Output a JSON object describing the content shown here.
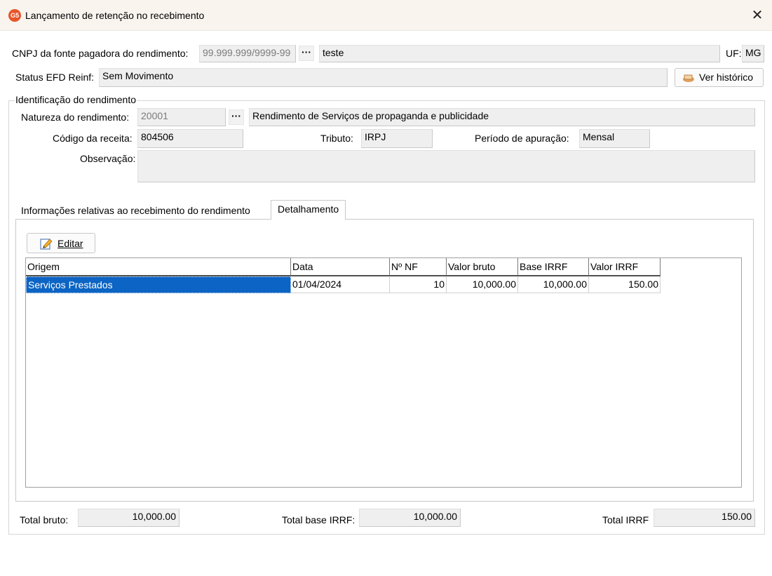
{
  "window": {
    "title": "Lançamento de retenção no recebimento",
    "icon_text": "G5",
    "close_glyph": "✕"
  },
  "header": {
    "cnpj_label": "CNPJ da fonte pagadora do rendimento:",
    "cnpj_value": "99.999.999/9999-99",
    "cnpj_lookup": "···",
    "cnpj_name": "teste",
    "uf_label": "UF:",
    "uf_value": "MG",
    "status_label": "Status EFD Reinf:",
    "status_value": "Sem Movimento",
    "history_button": "Ver histórico"
  },
  "identificacao": {
    "group_title": "Identificação do rendimento",
    "natureza_label": "Natureza do rendimento:",
    "natureza_code": "20001",
    "natureza_lookup": "···",
    "natureza_desc": "Rendimento de Serviços de propaganda e publicidade",
    "codigo_label": "Código da receita:",
    "codigo_value": "804506",
    "tributo_label": "Tributo:",
    "tributo_value": "IRPJ",
    "periodo_label": "Período de apuração:",
    "periodo_value": "Mensal",
    "observacao_label": "Observação:",
    "observacao_value": ""
  },
  "tabs": [
    {
      "label": "Informações relativas ao recebimento do rendimento",
      "active": false
    },
    {
      "label": "Detalhamento",
      "active": true
    }
  ],
  "detalhamento": {
    "edit_button": "Editar",
    "columns": [
      "Origem",
      "Data",
      "Nº NF",
      "Valor bruto",
      "Base IRRF",
      "Valor IRRF"
    ],
    "rows": [
      {
        "origem": "Serviços Prestados",
        "data": "01/04/2024",
        "nf": "10",
        "valor_bruto": "10,000.00",
        "base_irrf": "10,000.00",
        "valor_irrf": "150.00"
      }
    ],
    "selection_color": "#0c64c4"
  },
  "totals": {
    "bruto_label": "Total bruto:",
    "bruto_value": "10,000.00",
    "base_label": "Total base IRRF:",
    "base_value": "10,000.00",
    "irrf_label": "Total IRRF",
    "irrf_value": "150.00"
  }
}
